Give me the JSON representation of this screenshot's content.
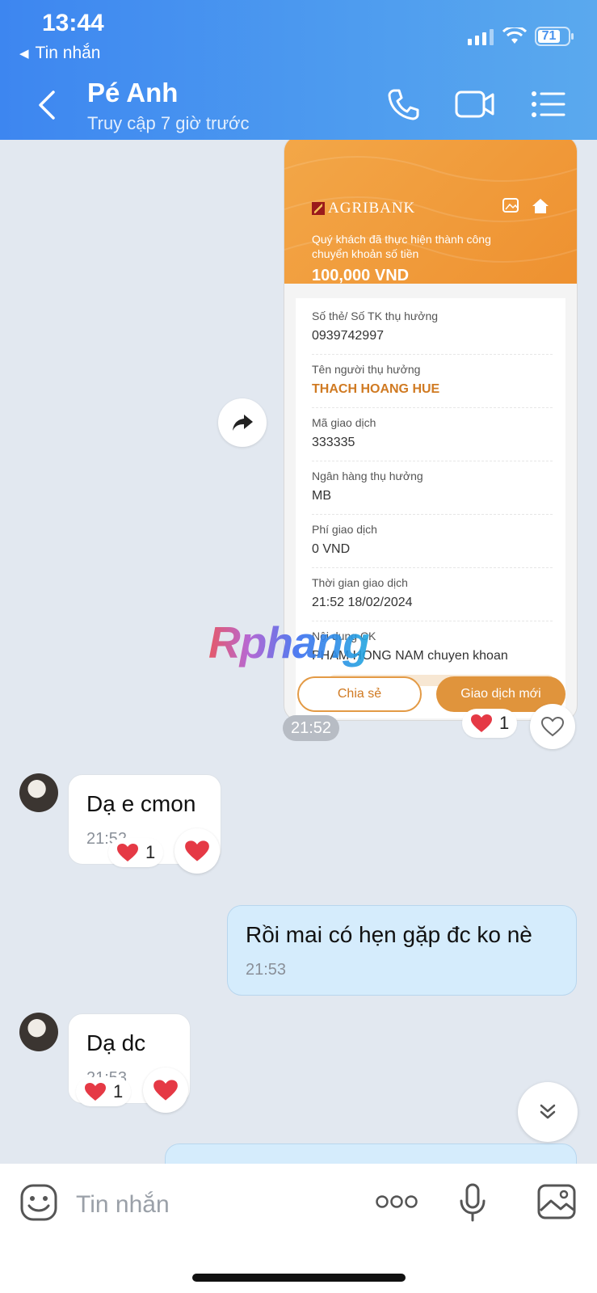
{
  "status_bar": {
    "time": "13:44",
    "back_app": "Tin nhắn",
    "battery": "71"
  },
  "header": {
    "contact_name": "Pé Anh",
    "contact_status": "Truy cập 7 giờ trước"
  },
  "receipt": {
    "bank": "AGRIBANK",
    "message": "Quý khách đã thực hiện thành công chuyển khoản số tiền",
    "amount": "100,000 VND",
    "fields": [
      {
        "label": "Số thẻ/ Số TK thụ hưởng",
        "value": "0939742997"
      },
      {
        "label": "Tên người thụ hưởng",
        "value": "THACH HOANG HUE"
      },
      {
        "label": "Mã giao dịch",
        "value": "333335"
      },
      {
        "label": "Ngân hàng thụ hưởng",
        "value": "MB"
      },
      {
        "label": "Phí giao dịch",
        "value": "0 VND"
      },
      {
        "label": "Thời gian giao dịch",
        "value": "21:52 18/02/2024"
      },
      {
        "label": "Nội dung CK",
        "value": "PHAM HONG NAM chuyen khoan"
      }
    ],
    "share_label": "Chia sẻ",
    "new_label": "Giao dịch mới"
  },
  "watermark": "Rphang",
  "messages": [
    {
      "time_pill": "21:52",
      "reaction_count": "1"
    },
    {
      "text": "Dạ e cmon",
      "time": "21:52",
      "reaction_count": "1"
    },
    {
      "text": "Rồi mai có hẹn gặp đc ko nè",
      "time": "21:53"
    },
    {
      "text": "Dạ dc",
      "time": "21:53",
      "reaction_count": "1"
    }
  ],
  "input": {
    "placeholder": "Tin nhắn"
  },
  "icons": [
    "phone-icon",
    "video-call-icon",
    "menu-list-icon",
    "share-forward-icon",
    "heart-icon",
    "heart-outline-icon",
    "chevrons-down-icon",
    "emoji-sticker-icon",
    "more-icon",
    "microphone-icon",
    "image-gallery-icon"
  ],
  "colors": {
    "header": "#4a93ee",
    "outgoing_bubble": "#d5ecfc",
    "receipt_orange": "#ee9130",
    "heart": "#e53945"
  }
}
